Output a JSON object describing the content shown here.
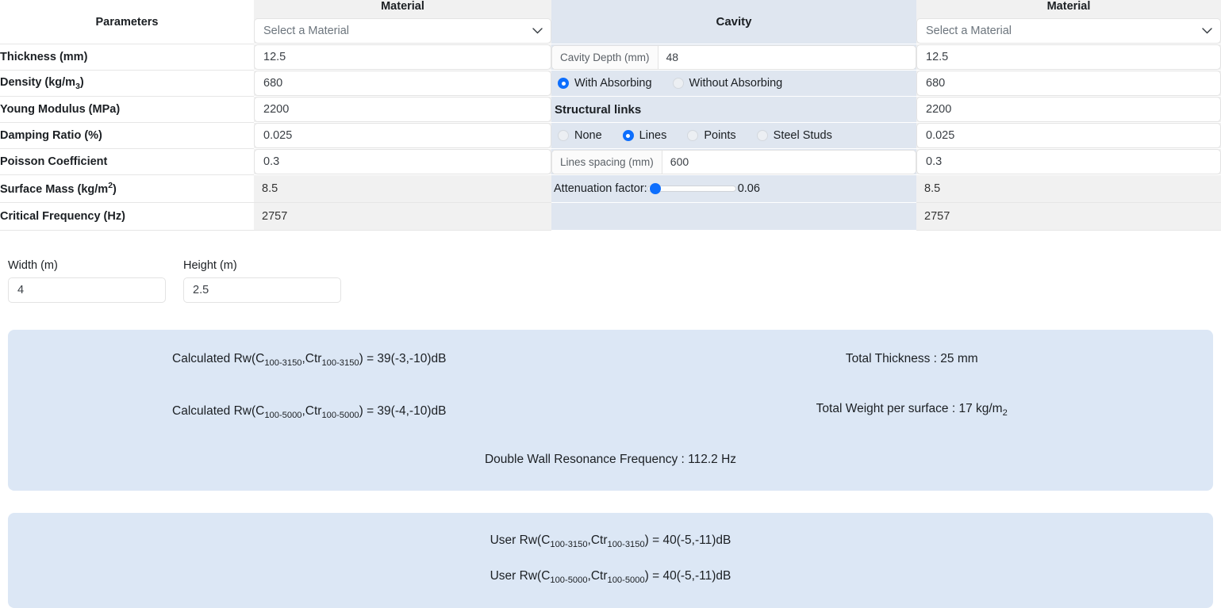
{
  "table": {
    "param_header": "Parameters",
    "material_left_header": "Material",
    "material_right_header": "Material",
    "cavity_header": "Cavity",
    "material_select_placeholder": "Select a Material",
    "rows": [
      {
        "label": "Thickness (mm)",
        "label_sub": "",
        "left": "12.5",
        "right": "12.5",
        "type": "input"
      },
      {
        "label": "Density (kg/m",
        "label_sub": "3",
        "label_tail": ")",
        "left": "680",
        "right": "680",
        "type": "input"
      },
      {
        "label": "Young Modulus (MPa)",
        "label_sub": "",
        "left": "2200",
        "right": "2200",
        "type": "input"
      },
      {
        "label": "Damping Ratio (%)",
        "label_sub": "",
        "left": "0.025",
        "right": "0.025",
        "type": "input"
      },
      {
        "label": "Poisson Coefficient",
        "label_sub": "",
        "left": "0.3",
        "right": "0.3",
        "type": "input"
      },
      {
        "label": "Surface Mass (kg/m",
        "label_sup": "2",
        "label_tail": ")",
        "left": "8.5",
        "right": "8.5",
        "type": "text"
      },
      {
        "label": "Critical Frequency (Hz)",
        "label_sub": "",
        "left": "2757",
        "right": "2757",
        "type": "text"
      }
    ]
  },
  "cavity": {
    "depth_label": "Cavity Depth (mm)",
    "depth_value": "48",
    "absorbing": {
      "options": [
        {
          "label": "With Absorbing",
          "selected": true
        },
        {
          "label": "Without Absorbing",
          "selected": false
        }
      ]
    },
    "structural_links_label": "Structural links",
    "links": {
      "options": [
        {
          "label": "None",
          "selected": false
        },
        {
          "label": "Lines",
          "selected": true
        },
        {
          "label": "Points",
          "selected": false
        },
        {
          "label": "Steel Studs",
          "selected": false
        }
      ]
    },
    "spacing_label": "Lines spacing (mm)",
    "spacing_value": "600",
    "attenuation_label": "Attenuation factor:",
    "attenuation_value": "0.06"
  },
  "dimensions": {
    "width_label": "Width (m)",
    "width_value": "4",
    "height_label": "Height (m)",
    "height_value": "2.5"
  },
  "results": {
    "calc_rw_3150_prefix": "Calculated Rw(C",
    "calc_rw_3150_sub1": "100-3150",
    "calc_rw_3150_mid": ",Ctr",
    "calc_rw_3150_sub2": "100-3150",
    "calc_rw_3150_suffix": ") = 39(-3,-10)dB",
    "calc_rw_5000_prefix": "Calculated Rw(C",
    "calc_rw_5000_sub1": "100-5000",
    "calc_rw_5000_mid": ",Ctr",
    "calc_rw_5000_sub2": "100-5000",
    "calc_rw_5000_suffix": ") = 39(-4,-10)dB",
    "total_thickness": "Total Thickness : 25 mm",
    "total_weight_prefix": "Total Weight per surface : 17 kg/m",
    "total_weight_sub": "2",
    "double_wall": "Double Wall Resonance Frequency : 112.2 Hz",
    "user_rw_3150_prefix": "User Rw(C",
    "user_rw_3150_sub1": "100-3150",
    "user_rw_3150_mid": ",Ctr",
    "user_rw_3150_sub2": "100-3150",
    "user_rw_3150_suffix": ") = 40(-5,-11)dB",
    "user_rw_5000_prefix": "User Rw(C",
    "user_rw_5000_sub1": "100-5000",
    "user_rw_5000_mid": ",Ctr",
    "user_rw_5000_sub2": "100-5000",
    "user_rw_5000_suffix": ") = 40(-5,-11)dB"
  },
  "colors": {
    "accent": "#0d6efd",
    "cavity_bg": "#dfe6f0",
    "material_bg": "#f1f1f1",
    "results_bg": "#dce7f5"
  }
}
